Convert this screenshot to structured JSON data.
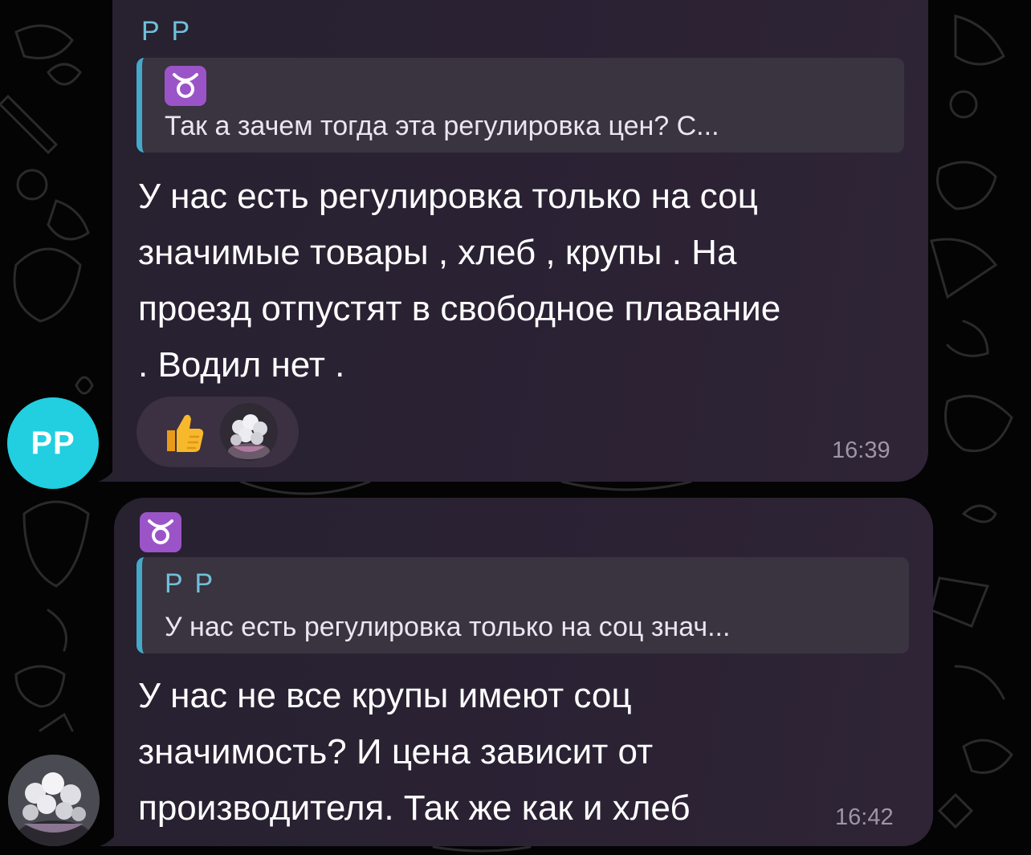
{
  "messages": [
    {
      "sender": "P P",
      "reply": {
        "emoji_icon": "taurus-icon",
        "text": "Так а зачем тогда эта регулировка цен? С..."
      },
      "lines": [
        "У нас есть регулировка только на соц",
        "значимые товары , хлеб , крупы . На",
        "проезд отпустят в свободное плавание",
        ". Водил нет ."
      ],
      "reactions": [
        "thumbs-up-icon",
        "bouquet-avatar"
      ],
      "time": "16:39"
    },
    {
      "header_emoji_icon": "taurus-icon",
      "reply": {
        "name": "P P",
        "text": "У нас есть регулировка только на соц знач..."
      },
      "lines": [
        "У нас не все крупы имеют соц",
        "значимость? И цена зависит от",
        "производителя. Так же как и хлеб"
      ],
      "time": "16:42"
    }
  ],
  "avatars": {
    "first": {
      "initials": "PP",
      "color": "#21cfe0"
    },
    "second": {
      "type": "photo",
      "icon": "bouquet-photo"
    }
  },
  "colors": {
    "background": "#040404",
    "bubble": "#2b2234",
    "quote_bar": "#45a9c9",
    "name": "#6fc0d8",
    "time": "#9d96a6"
  }
}
